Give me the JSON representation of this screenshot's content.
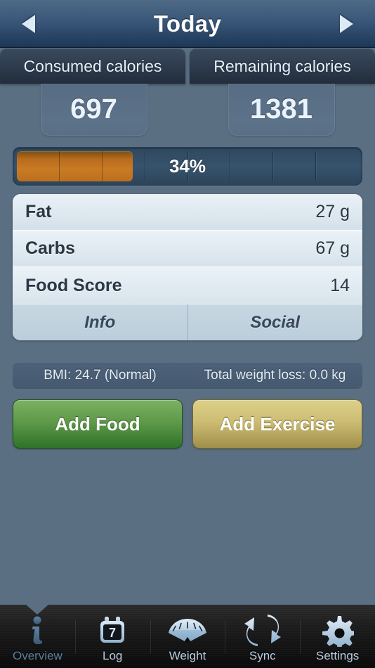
{
  "navbar": {
    "title": "Today",
    "prev_icon": "triangle-left-icon",
    "next_icon": "triangle-right-icon"
  },
  "summary": {
    "tabs": [
      {
        "label": "Consumed calories",
        "value": "697"
      },
      {
        "label": "Remaining calories",
        "value": "1381"
      }
    ]
  },
  "progress": {
    "label": "34%",
    "percent": 34,
    "segments": 8,
    "fill_color": "#c07423",
    "track_color": "#34506a"
  },
  "nutrients": {
    "rows": [
      {
        "label": "Fat",
        "value": "27 g"
      },
      {
        "label": "Carbs",
        "value": "67 g"
      },
      {
        "label": "Food Score",
        "value": "14"
      }
    ],
    "footer": [
      {
        "label": "Info"
      },
      {
        "label": "Social"
      }
    ]
  },
  "stats": {
    "items": [
      {
        "text": "BMI: 24.7 (Normal)"
      },
      {
        "text": "Total weight loss: 0.0 kg"
      }
    ]
  },
  "actions": [
    {
      "label": "Add Food",
      "color": "#5f9a49"
    },
    {
      "label": "Add Exercise",
      "color": "#cdbd73"
    }
  ],
  "tabbar": {
    "selected": "Overview",
    "items": [
      {
        "label": "Overview",
        "icon": "info-icon"
      },
      {
        "label": "Log",
        "icon": "calendar-icon",
        "badge": "7"
      },
      {
        "label": "Weight",
        "icon": "scale-gauge-icon"
      },
      {
        "label": "Sync",
        "icon": "sync-arrows-icon"
      },
      {
        "label": "Settings",
        "icon": "gear-icon"
      }
    ]
  }
}
